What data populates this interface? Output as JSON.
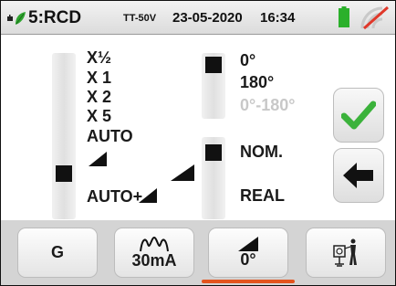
{
  "header": {
    "function": "5:RCD",
    "system": "TT-50V",
    "date": "23-05-2020",
    "time": "16:34",
    "icons": [
      "leaf-plug-icon",
      "battery-full-icon",
      "wireless-disabled-icon"
    ],
    "battery_color": "#2bb02b",
    "signal_slash_color": "#e0382a"
  },
  "multiplier": {
    "options": [
      "X½",
      "X 1",
      "X 2",
      "X 5",
      "AUTO",
      "AUTO+"
    ],
    "selected": "auto-ramp"
  },
  "phase": {
    "options": [
      "0°",
      "180°",
      "0°-180°"
    ],
    "selected": "0°"
  },
  "mode": {
    "options": [
      "NOM.",
      "REAL"
    ],
    "selected": "NOM."
  },
  "side_buttons": [
    "confirm-check-icon",
    "back-arrow-icon"
  ],
  "tabs": [
    {
      "label": "G"
    },
    {
      "label": "30mA",
      "icon": "waveform-icon"
    },
    {
      "label": "0°",
      "icon": "ramp-icon",
      "active": true
    },
    {
      "icon": "earth-probe-icon"
    }
  ],
  "colors": {
    "accent": "#e3541e",
    "check": "#3bb23b"
  }
}
